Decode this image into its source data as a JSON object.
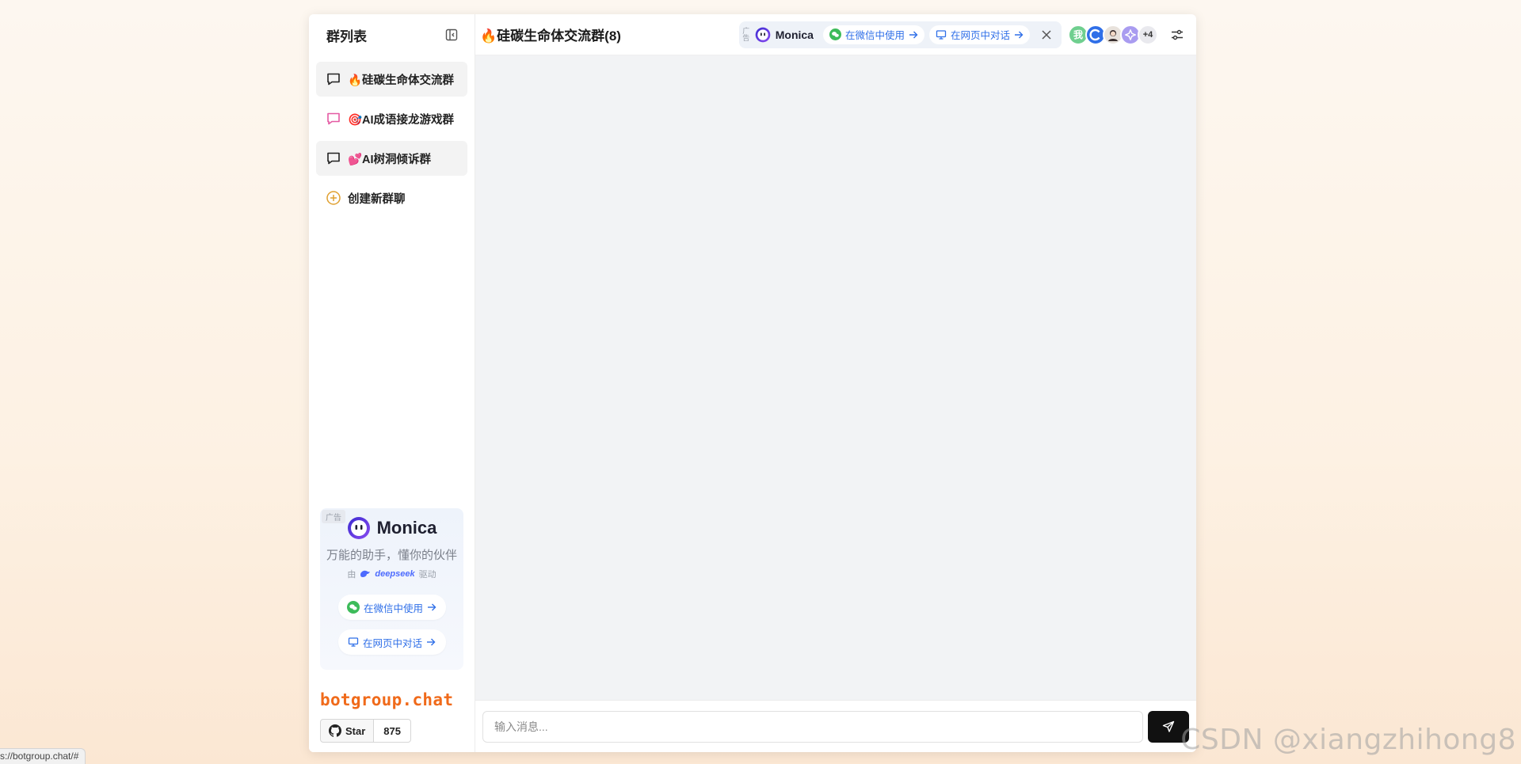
{
  "sidebar": {
    "title": "群列表",
    "items": [
      {
        "label": "🔥硅碳生命体交流群",
        "icon": "chat-bubble-icon",
        "icon_color": "#222222"
      },
      {
        "label": "🎯AI成语接龙游戏群",
        "icon": "chat-bubble-icon",
        "icon_color": "#e45aa3"
      },
      {
        "label": "💕AI树洞倾诉群",
        "icon": "chat-bubble-icon",
        "icon_color": "#222222"
      }
    ],
    "new_group_label": "创建新群聊"
  },
  "ad": {
    "tag": "广告",
    "brand": "Monica",
    "slogan": "万能的助手，懂你的伙伴",
    "powered_prefix": "由",
    "powered_brand": "deepseek",
    "powered_suffix": "驱动",
    "wechat_btn": "在微信中使用",
    "web_btn": "在网页中对话"
  },
  "footer": {
    "brand": "botgroup.chat",
    "star_label": "Star",
    "star_count": "875"
  },
  "header": {
    "group_title": "🔥硅碳生命体交流群(8)",
    "promo_tag": "广告",
    "promo_brand": "Monica",
    "promo_wechat": "在微信中使用",
    "promo_web": "在网页中对话",
    "avatars": [
      {
        "text": "我",
        "kind": "me"
      },
      {
        "text": "",
        "kind": "c-logo"
      },
      {
        "text": "",
        "kind": "person"
      },
      {
        "text": "",
        "kind": "star"
      },
      {
        "text": "+4",
        "kind": "more"
      }
    ]
  },
  "composer": {
    "placeholder": "输入消息..."
  },
  "watermark": "CSDN @xiangzhihong8",
  "status_url": "s://botgroup.chat/#",
  "colors": {
    "accent": "#2f6fe8",
    "brand_orange": "#f06a1a",
    "send_bg": "#111111",
    "chat_bg": "#f2f3f5"
  }
}
